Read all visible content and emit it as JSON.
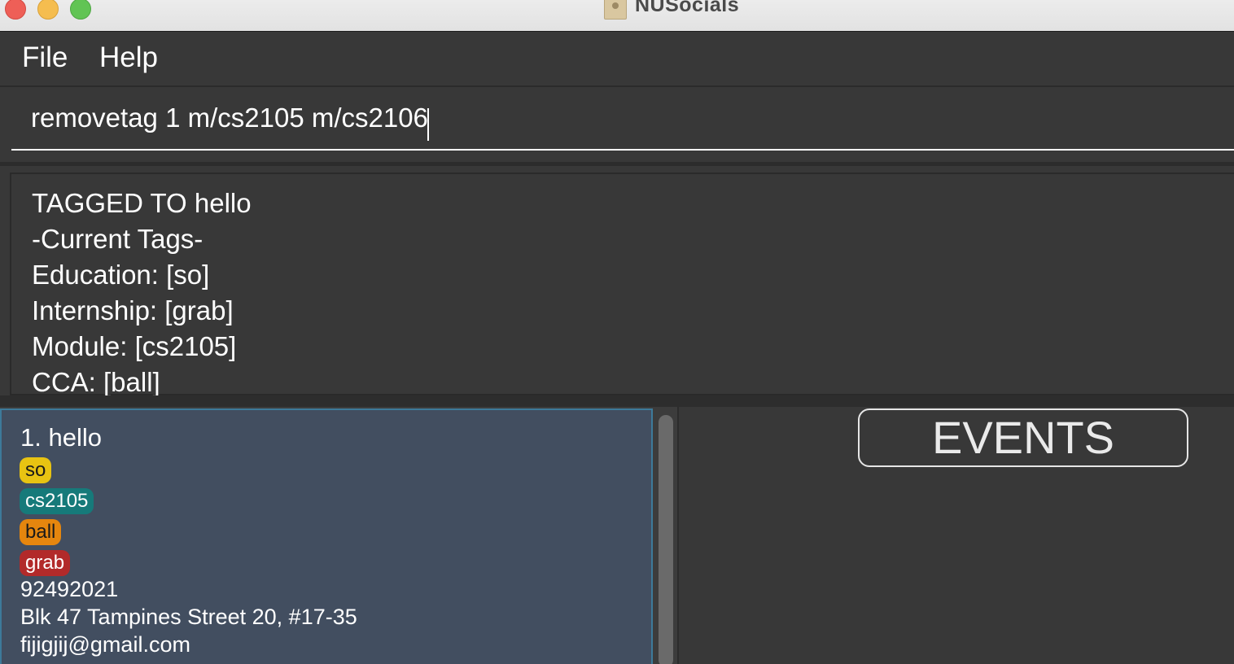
{
  "window": {
    "title": "NUSocials",
    "icon": "contact-book-icon"
  },
  "menu": {
    "file_label": "File",
    "help_label": "Help"
  },
  "command": {
    "value": "removetag 1 m/cs2105 m/cs2106"
  },
  "result": {
    "lines": [
      "TAGGED TO hello",
      "-Current Tags-",
      "Education: [so]",
      "Internship: [grab]",
      "Module: [cs2105]",
      "CCA: [ball]"
    ]
  },
  "person_list": {
    "people": [
      {
        "name": "1.  hello",
        "tags": [
          {
            "label": "so",
            "color": "#e8c312"
          },
          {
            "label": "cs2105",
            "color": "#167a7a"
          },
          {
            "label": "ball",
            "color": "#e5860e"
          },
          {
            "label": "grab",
            "color": "#b22a2a"
          }
        ],
        "phone": "92492021",
        "address": "Blk 47 Tampines Street 20, #17-35",
        "email": "fijigjij@gmail.com"
      }
    ]
  },
  "events": {
    "button_label": "EVENTS"
  },
  "colors": {
    "background": "#383838",
    "card_selected": "#424e60",
    "card_border": "#3d7a9a"
  }
}
